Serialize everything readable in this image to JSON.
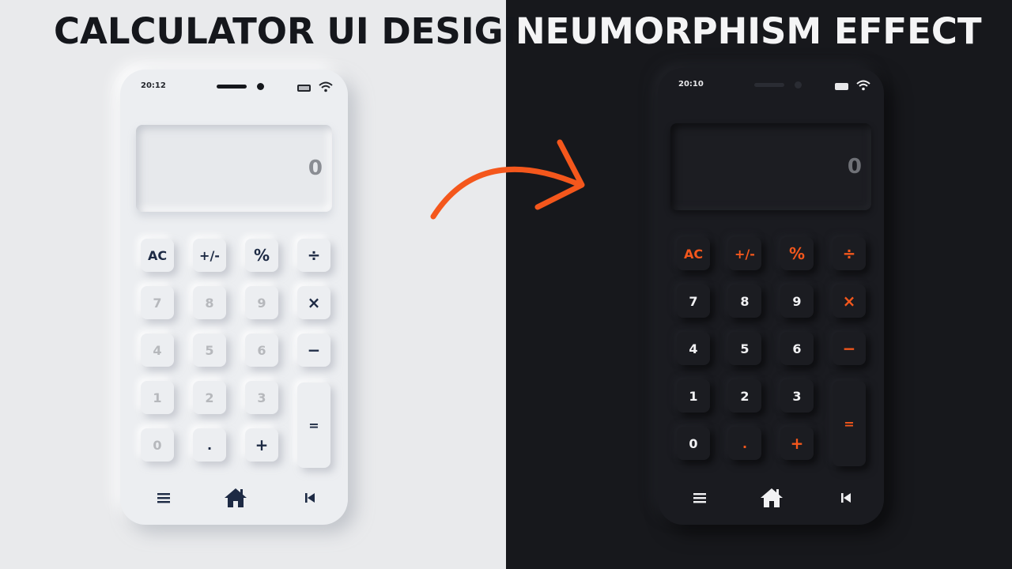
{
  "headline": {
    "part1": "CALCULATOR UI DESIGN",
    "part2": "NEUMORPHISM EFFECT"
  },
  "colors": {
    "accent": "#f4571c",
    "light_bg": "#e9eaec",
    "dark_bg": "#17181c",
    "light_key_text": "#1d2a44"
  },
  "light_phone": {
    "time": "20:12",
    "display": "0",
    "keys": [
      "AC",
      "+/-",
      "%",
      "÷",
      "7",
      "8",
      "9",
      "×",
      "4",
      "5",
      "6",
      "−",
      "1",
      "2",
      "3",
      "=",
      "0",
      ".",
      "+"
    ],
    "nav": [
      "menu-icon",
      "home-icon",
      "skip-back-icon"
    ]
  },
  "dark_phone": {
    "time": "20:10",
    "display": "0",
    "keys": [
      "AC",
      "+/-",
      "%",
      "÷",
      "7",
      "8",
      "9",
      "×",
      "4",
      "5",
      "6",
      "−",
      "1",
      "2",
      "3",
      "=",
      "0",
      ".",
      "+"
    ],
    "nav": [
      "menu-icon",
      "home-icon",
      "skip-back-icon"
    ]
  }
}
